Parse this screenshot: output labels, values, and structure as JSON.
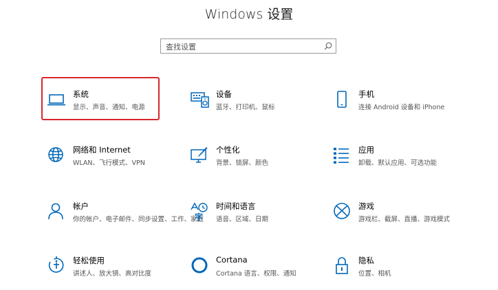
{
  "window": {
    "title": "Windows 设置"
  },
  "search": {
    "placeholder": "查找设置",
    "icon": "search-icon"
  },
  "accent": "#0067b8",
  "highlight_color": "#d9252a",
  "tiles": [
    {
      "title": "系统",
      "desc": "显示、声音、通知、电源",
      "icon": "laptop-icon",
      "highlighted": true
    },
    {
      "title": "设备",
      "desc": "蓝牙、打印机、鼠标",
      "icon": "keyboard-speaker-icon"
    },
    {
      "title": "手机",
      "desc": "连接 Android 设备和 iPhone",
      "icon": "phone-icon"
    },
    {
      "title": "网络和 Internet",
      "desc": "WLAN、飞行模式、VPN",
      "icon": "globe-icon"
    },
    {
      "title": "个性化",
      "desc": "背景、锁屏、颜色",
      "icon": "paint-monitor-icon"
    },
    {
      "title": "应用",
      "desc": "卸载、默认应用、可选功能",
      "icon": "app-list-icon"
    },
    {
      "title": "帐户",
      "desc": "你的帐户、电子邮件、同步设置、工作、家庭",
      "icon": "person-icon"
    },
    {
      "title": "时间和语言",
      "desc": "语音、区域、日期",
      "icon": "time-language-icon"
    },
    {
      "title": "游戏",
      "desc": "游戏栏、截屏、直播、游戏模式",
      "icon": "xbox-icon"
    },
    {
      "title": "轻松使用",
      "desc": "讲述人、放大镜、高对比度",
      "icon": "ease-of-access-icon"
    },
    {
      "title": "Cortana",
      "desc": "Cortana 语言、权限、通知",
      "icon": "cortana-icon"
    },
    {
      "title": "隐私",
      "desc": "位置、相机",
      "icon": "lock-icon"
    }
  ]
}
